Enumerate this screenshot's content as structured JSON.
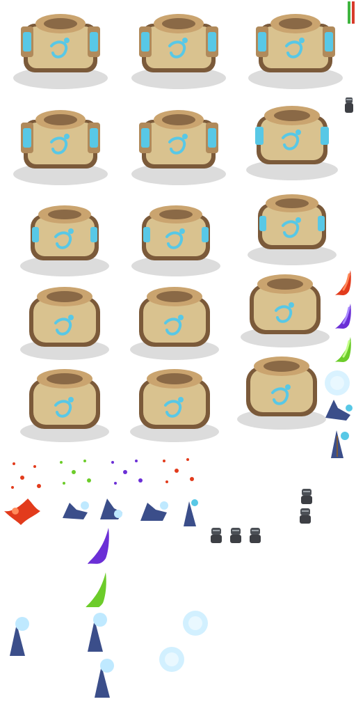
{
  "sheet": {
    "description_colors": {
      "tower_stone": "#d9c28f",
      "tower_shadow": "#7b5a3a",
      "rune_glow": "#58c8e6",
      "mage_robe": "#3b4e8a",
      "fire_red": "#e23b1c",
      "arcane_purple": "#6b2fd6",
      "poison_green": "#6ccc2a",
      "ice_glow": "#bfe9ff",
      "knight_armor": "#4b4f55",
      "health_green": "#3fb53f",
      "health_red": "#d83b2b"
    },
    "icons": [
      "mage-tower-icon",
      "wizard-icon",
      "knight-icon",
      "fire-comet-icon",
      "poison-comet-icon",
      "arcane-comet-icon",
      "ice-burst-icon",
      "health-bar-icon"
    ]
  }
}
